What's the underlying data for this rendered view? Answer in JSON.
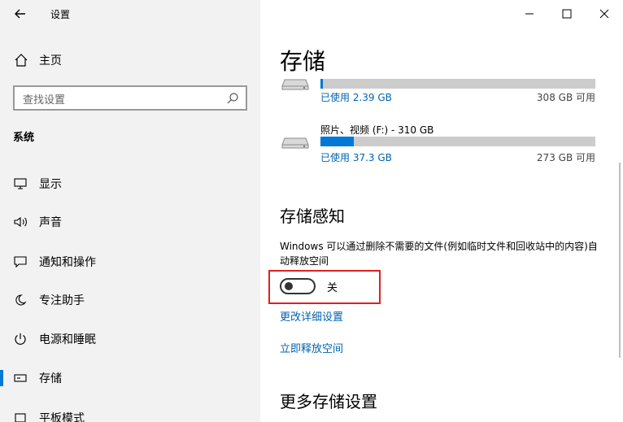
{
  "window": {
    "title": "设置",
    "back_icon": "back-arrow-icon"
  },
  "sidebar": {
    "home_label": "主页",
    "search_placeholder": "查找设置",
    "section_title": "系统",
    "items": [
      {
        "label": "显示",
        "icon": "display-icon"
      },
      {
        "label": "声音",
        "icon": "speaker-icon"
      },
      {
        "label": "通知和操作",
        "icon": "notification-icon"
      },
      {
        "label": "专注助手",
        "icon": "moon-icon"
      },
      {
        "label": "电源和睡眠",
        "icon": "power-icon"
      },
      {
        "label": "存储",
        "icon": "storage-icon",
        "active": true
      },
      {
        "label": "平板模式",
        "icon": "tablet-icon"
      }
    ]
  },
  "content": {
    "title": "存储",
    "drives": [
      {
        "name": "",
        "used": "已使用 2.39 GB",
        "free": "308 GB 可用",
        "used_fraction": 0.0077
      },
      {
        "name": "照片、视频 (F:) - 310 GB",
        "used": "已使用 37.3 GB",
        "free": "273 GB 可用",
        "used_fraction": 0.12
      }
    ],
    "storage_sense": {
      "heading": "存储感知",
      "description": "Windows 可以通过删除不需要的文件(例如临时文件和回收站中的内容)自动释放空间",
      "toggle_state": "关",
      "toggle_on": false,
      "link_change": "更改详细设置",
      "link_free_now": "立即释放空间"
    },
    "more_heading": "更多存储设置"
  },
  "colors": {
    "accent": "#0078d7",
    "link": "#0063b1",
    "highlight": "#e02020"
  }
}
